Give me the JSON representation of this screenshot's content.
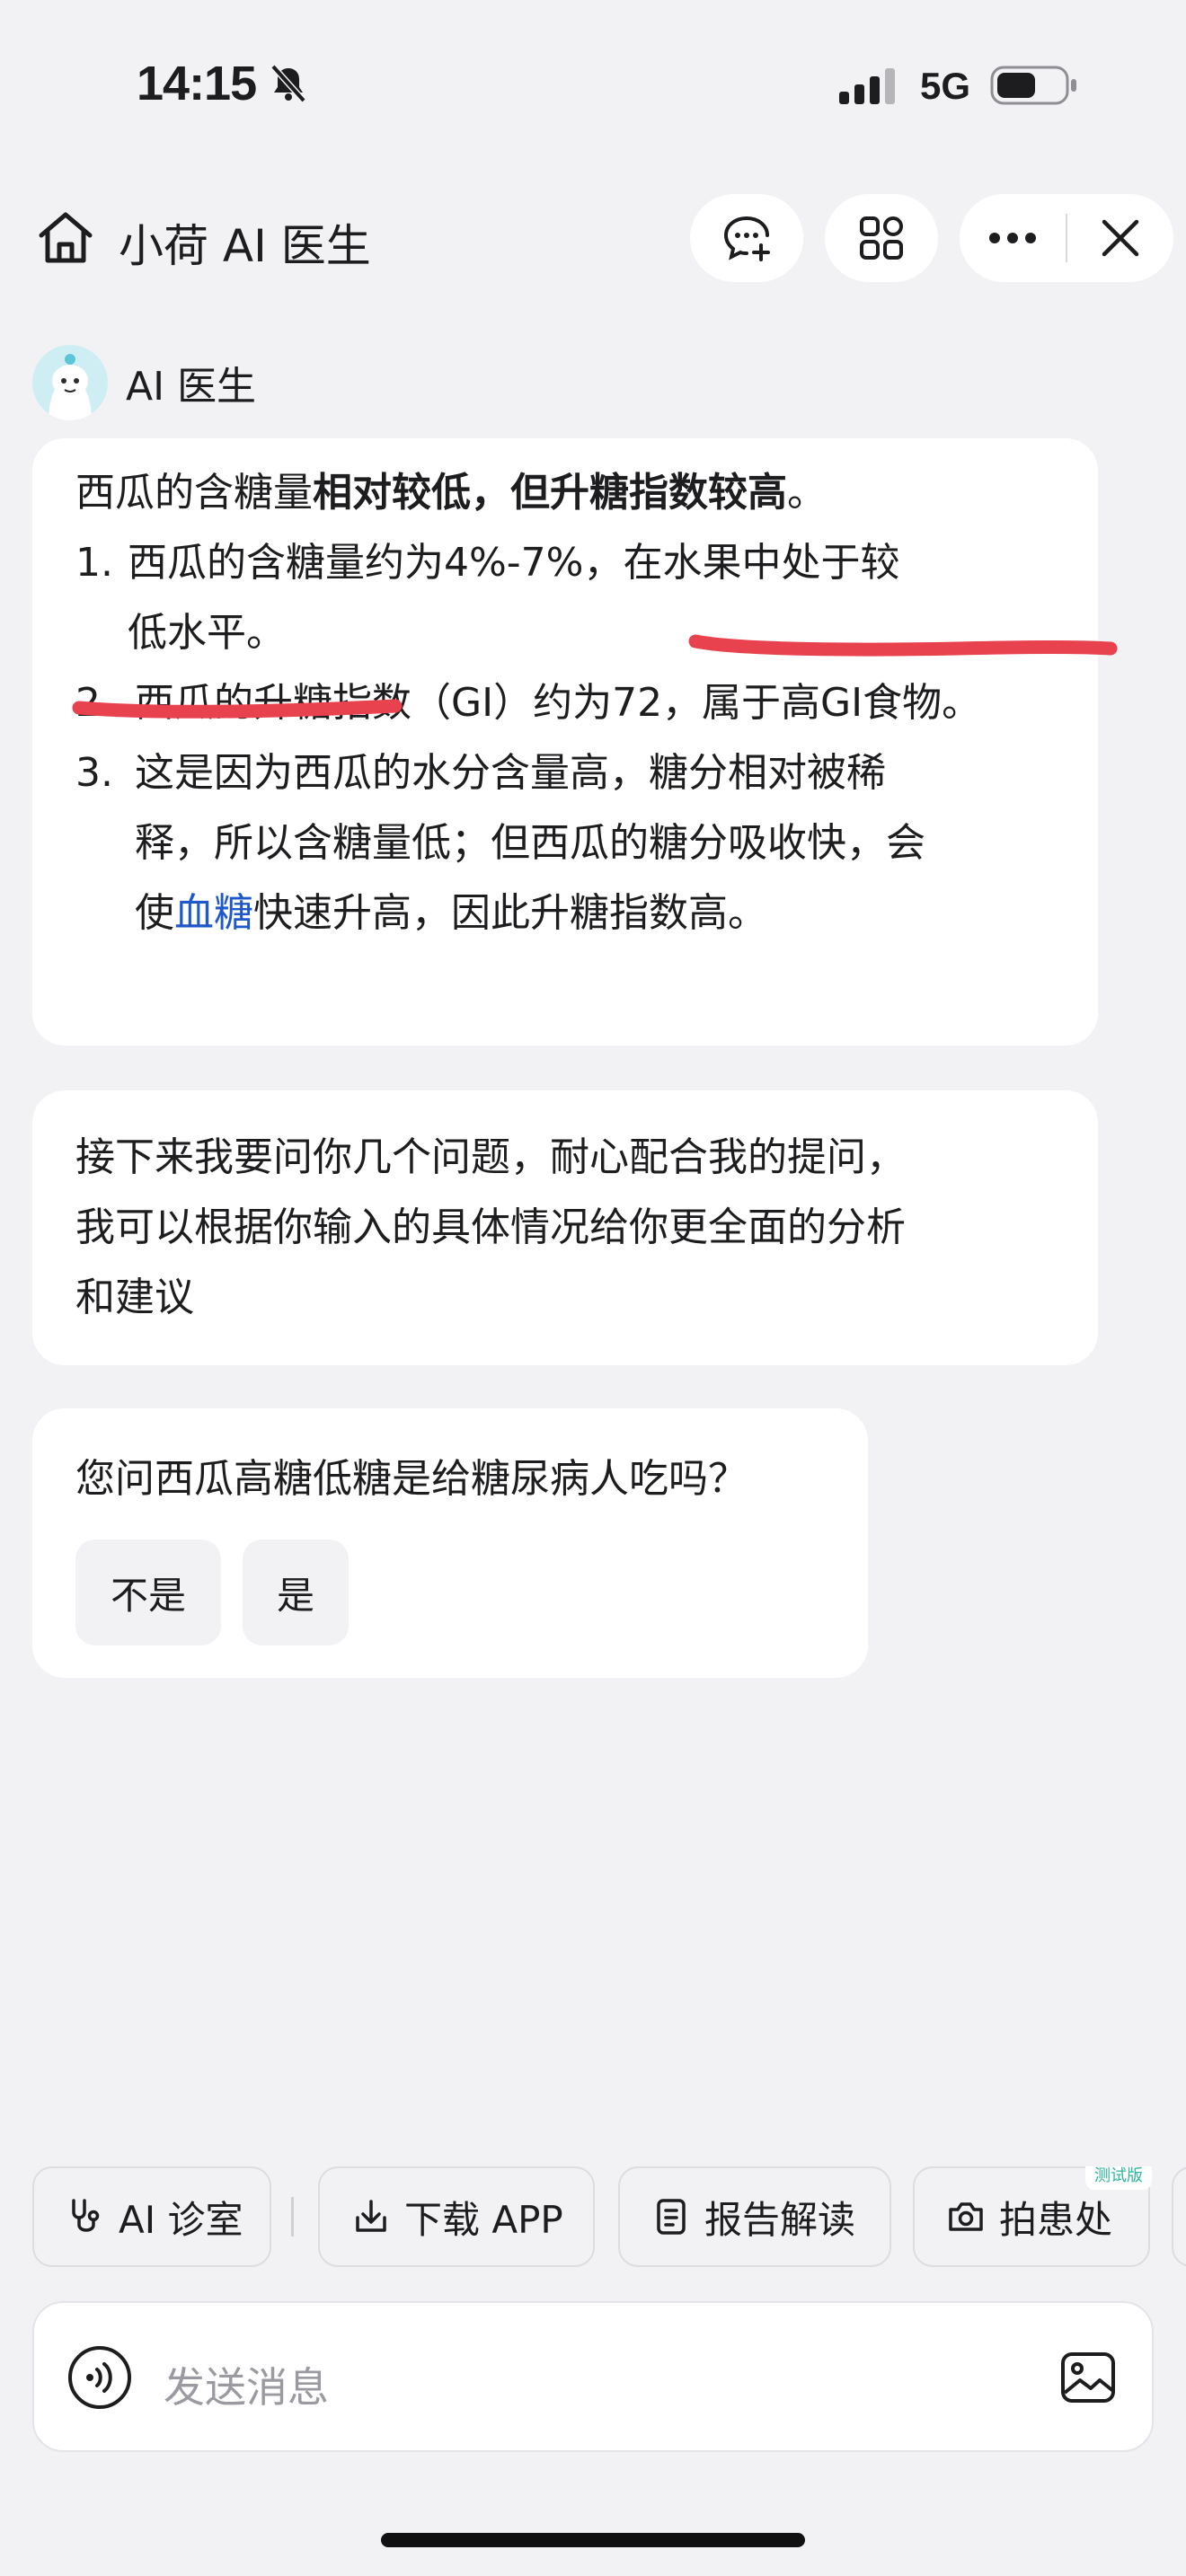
{
  "status_bar": {
    "time": "14:15",
    "network": "5G"
  },
  "nav": {
    "title": "小荷 AI 医生"
  },
  "assistant": {
    "name": "AI 医生"
  },
  "message1": {
    "intro_normal": "西瓜的含糖量",
    "intro_bold": "相对较低，但升糖指数较高",
    "intro_end": "。",
    "items": [
      {
        "num": "1.",
        "line1": "西瓜的含糖量约为4%-7%，在水果中处于较",
        "line2": "低水平。"
      },
      {
        "num": "2.",
        "line1": "西瓜的升糖指数（GI）约为72，属于高GI食物。"
      },
      {
        "num": "3.",
        "line1": "这是因为西瓜的水分含量高，糖分相对被稀",
        "line2": "释，所以含糖量低；但西瓜的糖分吸收快，会",
        "line3_pre": "使",
        "line3_link": "血糖",
        "line3_post": "快速升高，因此升糖指数高。"
      }
    ]
  },
  "message2": {
    "lines": [
      "接下来我要问你几个问题，耐心配合我的提问，",
      "我可以根据你输入的具体情况给你更全面的分析",
      "和建议"
    ]
  },
  "message3": {
    "question": "您问西瓜高糖低糖是给糖尿病人吃吗？",
    "options": [
      "不是",
      "是"
    ]
  },
  "quick_actions": [
    {
      "label": "AI 诊室",
      "icon": "stethoscope-icon"
    },
    {
      "label": "下载 APP",
      "icon": "download-icon"
    },
    {
      "label": "报告解读",
      "icon": "report-icon"
    },
    {
      "label": "拍患处",
      "icon": "camera-icon",
      "badge": "测试版"
    }
  ],
  "input": {
    "placeholder": "发送消息"
  },
  "colors": {
    "link": "#1f58c8",
    "annotation": "#e8424e",
    "background": "#f2f2f5"
  }
}
